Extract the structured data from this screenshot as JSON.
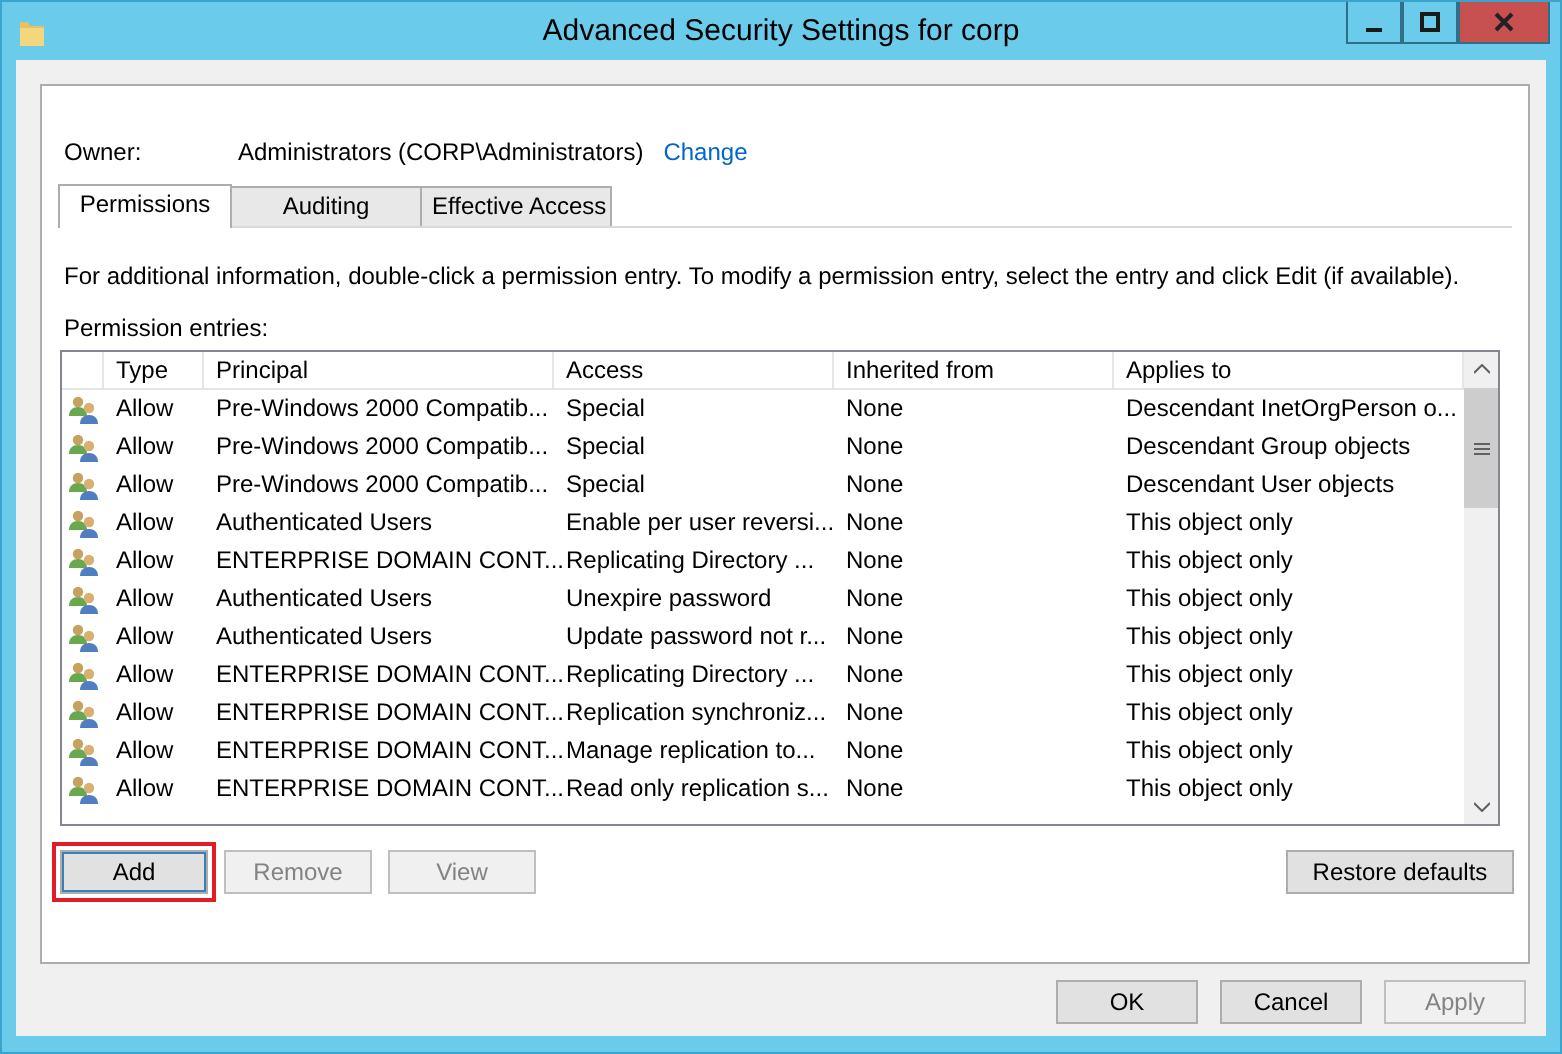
{
  "window": {
    "title": "Advanced Security Settings for corp"
  },
  "owner": {
    "label": "Owner:",
    "value": "Administrators (CORP\\Administrators)",
    "link": "Change"
  },
  "tabs": [
    {
      "label": "Permissions",
      "selected": true
    },
    {
      "label": "Auditing",
      "selected": false
    },
    {
      "label": "Effective Access",
      "selected": false
    }
  ],
  "info_text": "For additional information, double-click a permission entry. To modify a permission entry, select the entry and click Edit (if available).",
  "entries_label": "Permission entries:",
  "table": {
    "columns": [
      "Type",
      "Principal",
      "Access",
      "Inherited from",
      "Applies to"
    ],
    "rows": [
      [
        "Allow",
        "Pre-Windows 2000 Compatib...",
        "Special",
        "None",
        "Descendant InetOrgPerson o..."
      ],
      [
        "Allow",
        "Pre-Windows 2000 Compatib...",
        "Special",
        "None",
        "Descendant Group objects"
      ],
      [
        "Allow",
        "Pre-Windows 2000 Compatib...",
        "Special",
        "None",
        "Descendant User objects"
      ],
      [
        "Allow",
        "Authenticated Users",
        "Enable per user reversi...",
        "None",
        "This object only"
      ],
      [
        "Allow",
        "ENTERPRISE DOMAIN CONT...",
        "Replicating Directory ...",
        "None",
        "This object only"
      ],
      [
        "Allow",
        "Authenticated Users",
        "Unexpire password",
        "None",
        "This object only"
      ],
      [
        "Allow",
        "Authenticated Users",
        "Update password not r...",
        "None",
        "This object only"
      ],
      [
        "Allow",
        "ENTERPRISE DOMAIN CONT...",
        "Replicating Directory ...",
        "None",
        "This object only"
      ],
      [
        "Allow",
        "ENTERPRISE DOMAIN CONT...",
        "Replication synchroniz...",
        "None",
        "This object only"
      ],
      [
        "Allow",
        "ENTERPRISE DOMAIN CONT...",
        "Manage replication to...",
        "None",
        "This object only"
      ],
      [
        "Allow",
        "ENTERPRISE DOMAIN CONT...",
        "Read only replication s...",
        "None",
        "This object only"
      ]
    ]
  },
  "list_buttons": [
    {
      "label": "Add",
      "disabled": false,
      "highlighted": true
    },
    {
      "label": "Remove",
      "disabled": true,
      "highlighted": false
    },
    {
      "label": "View",
      "disabled": true,
      "highlighted": false
    }
  ],
  "restore_button": {
    "label": "Restore defaults",
    "disabled": false
  },
  "dialog_buttons": [
    {
      "label": "OK",
      "disabled": false
    },
    {
      "label": "Cancel",
      "disabled": false
    },
    {
      "label": "Apply",
      "disabled": true
    }
  ]
}
